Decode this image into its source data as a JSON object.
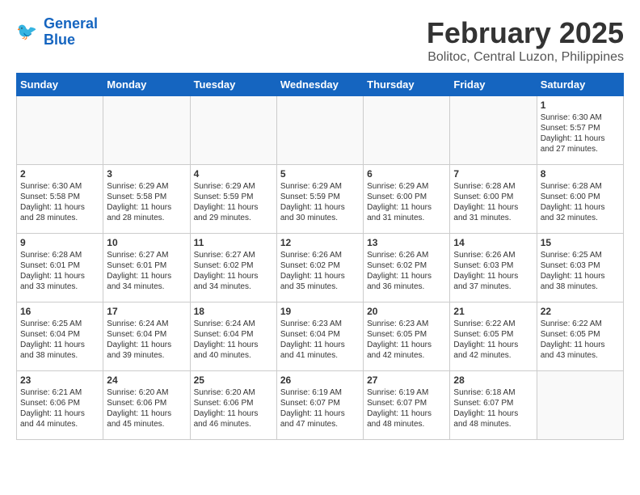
{
  "header": {
    "logo_line1": "General",
    "logo_line2": "Blue",
    "month_year": "February 2025",
    "location": "Bolitoc, Central Luzon, Philippines"
  },
  "weekdays": [
    "Sunday",
    "Monday",
    "Tuesday",
    "Wednesday",
    "Thursday",
    "Friday",
    "Saturday"
  ],
  "weeks": [
    [
      {
        "day": "",
        "info": ""
      },
      {
        "day": "",
        "info": ""
      },
      {
        "day": "",
        "info": ""
      },
      {
        "day": "",
        "info": ""
      },
      {
        "day": "",
        "info": ""
      },
      {
        "day": "",
        "info": ""
      },
      {
        "day": "1",
        "info": "Sunrise: 6:30 AM\nSunset: 5:57 PM\nDaylight: 11 hours and 27 minutes."
      }
    ],
    [
      {
        "day": "2",
        "info": "Sunrise: 6:30 AM\nSunset: 5:58 PM\nDaylight: 11 hours and 28 minutes."
      },
      {
        "day": "3",
        "info": "Sunrise: 6:29 AM\nSunset: 5:58 PM\nDaylight: 11 hours and 28 minutes."
      },
      {
        "day": "4",
        "info": "Sunrise: 6:29 AM\nSunset: 5:59 PM\nDaylight: 11 hours and 29 minutes."
      },
      {
        "day": "5",
        "info": "Sunrise: 6:29 AM\nSunset: 5:59 PM\nDaylight: 11 hours and 30 minutes."
      },
      {
        "day": "6",
        "info": "Sunrise: 6:29 AM\nSunset: 6:00 PM\nDaylight: 11 hours and 31 minutes."
      },
      {
        "day": "7",
        "info": "Sunrise: 6:28 AM\nSunset: 6:00 PM\nDaylight: 11 hours and 31 minutes."
      },
      {
        "day": "8",
        "info": "Sunrise: 6:28 AM\nSunset: 6:00 PM\nDaylight: 11 hours and 32 minutes."
      }
    ],
    [
      {
        "day": "9",
        "info": "Sunrise: 6:28 AM\nSunset: 6:01 PM\nDaylight: 11 hours and 33 minutes."
      },
      {
        "day": "10",
        "info": "Sunrise: 6:27 AM\nSunset: 6:01 PM\nDaylight: 11 hours and 34 minutes."
      },
      {
        "day": "11",
        "info": "Sunrise: 6:27 AM\nSunset: 6:02 PM\nDaylight: 11 hours and 34 minutes."
      },
      {
        "day": "12",
        "info": "Sunrise: 6:26 AM\nSunset: 6:02 PM\nDaylight: 11 hours and 35 minutes."
      },
      {
        "day": "13",
        "info": "Sunrise: 6:26 AM\nSunset: 6:02 PM\nDaylight: 11 hours and 36 minutes."
      },
      {
        "day": "14",
        "info": "Sunrise: 6:26 AM\nSunset: 6:03 PM\nDaylight: 11 hours and 37 minutes."
      },
      {
        "day": "15",
        "info": "Sunrise: 6:25 AM\nSunset: 6:03 PM\nDaylight: 11 hours and 38 minutes."
      }
    ],
    [
      {
        "day": "16",
        "info": "Sunrise: 6:25 AM\nSunset: 6:04 PM\nDaylight: 11 hours and 38 minutes."
      },
      {
        "day": "17",
        "info": "Sunrise: 6:24 AM\nSunset: 6:04 PM\nDaylight: 11 hours and 39 minutes."
      },
      {
        "day": "18",
        "info": "Sunrise: 6:24 AM\nSunset: 6:04 PM\nDaylight: 11 hours and 40 minutes."
      },
      {
        "day": "19",
        "info": "Sunrise: 6:23 AM\nSunset: 6:04 PM\nDaylight: 11 hours and 41 minutes."
      },
      {
        "day": "20",
        "info": "Sunrise: 6:23 AM\nSunset: 6:05 PM\nDaylight: 11 hours and 42 minutes."
      },
      {
        "day": "21",
        "info": "Sunrise: 6:22 AM\nSunset: 6:05 PM\nDaylight: 11 hours and 42 minutes."
      },
      {
        "day": "22",
        "info": "Sunrise: 6:22 AM\nSunset: 6:05 PM\nDaylight: 11 hours and 43 minutes."
      }
    ],
    [
      {
        "day": "23",
        "info": "Sunrise: 6:21 AM\nSunset: 6:06 PM\nDaylight: 11 hours and 44 minutes."
      },
      {
        "day": "24",
        "info": "Sunrise: 6:20 AM\nSunset: 6:06 PM\nDaylight: 11 hours and 45 minutes."
      },
      {
        "day": "25",
        "info": "Sunrise: 6:20 AM\nSunset: 6:06 PM\nDaylight: 11 hours and 46 minutes."
      },
      {
        "day": "26",
        "info": "Sunrise: 6:19 AM\nSunset: 6:07 PM\nDaylight: 11 hours and 47 minutes."
      },
      {
        "day": "27",
        "info": "Sunrise: 6:19 AM\nSunset: 6:07 PM\nDaylight: 11 hours and 48 minutes."
      },
      {
        "day": "28",
        "info": "Sunrise: 6:18 AM\nSunset: 6:07 PM\nDaylight: 11 hours and 48 minutes."
      },
      {
        "day": "",
        "info": ""
      }
    ]
  ]
}
